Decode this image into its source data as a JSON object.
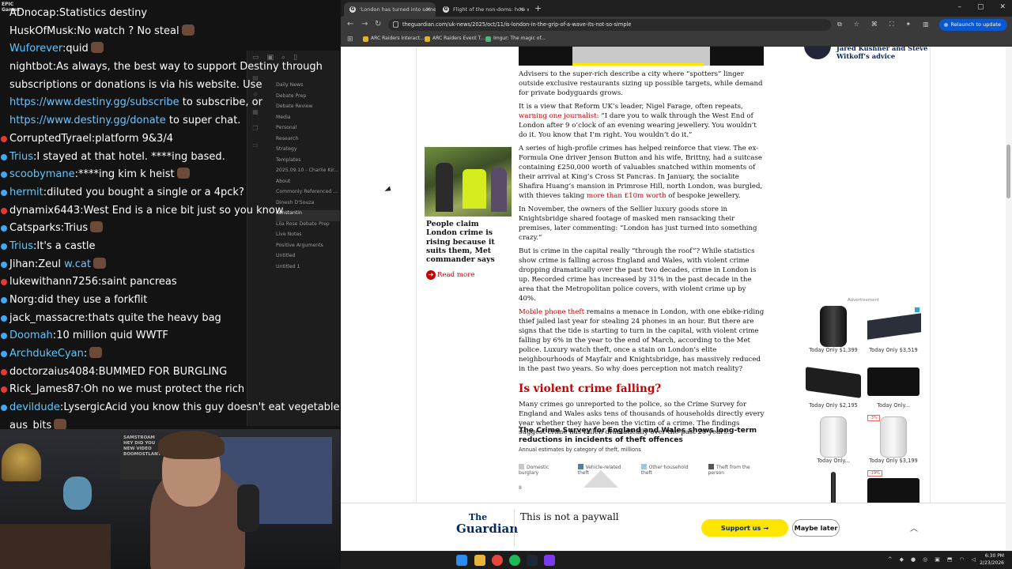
{
  "chat": {
    "badge": "EPIC\nGames",
    "lines": [
      {
        "user": "ADnocap",
        "text": "Statistics destiny",
        "dot": "none",
        "user_color": "white"
      },
      {
        "user": "HuskOfMusk",
        "text": "No watch ? No steal",
        "dot": "none",
        "user_color": "white",
        "emote": true
      },
      {
        "user": "Wuforever",
        "text": "quid",
        "dot": "none",
        "user_color": "blue",
        "emote": true
      },
      {
        "user": "nightbot",
        "text": "As always, the best way to support Destiny through",
        "dot": "none",
        "user_color": "white"
      },
      {
        "user": "",
        "text": "subscriptions or donations is via his website. Use",
        "dot": "none",
        "user_color": "white"
      },
      {
        "user": "",
        "text": "",
        "link": "https://www.destiny.gg/subscribe",
        "after": " to subscribe, or",
        "dot": "none"
      },
      {
        "user": "",
        "text": "",
        "link": "https://www.destiny.gg/donate",
        "after": " to super chat.",
        "dot": "none"
      },
      {
        "user": "CorruptedTyrael",
        "text": "platform 9&3/4",
        "dot": "red",
        "user_color": "white"
      },
      {
        "user": "Trius",
        "text": "I stayed at that hotel. ****ing based.",
        "dot": "blue",
        "user_color": "blue"
      },
      {
        "user": "scoobymane",
        "text": "****ing kim k heist",
        "dot": "blue",
        "user_color": "blue",
        "emote": true
      },
      {
        "user": "hermit",
        "text": "diluted you bought a single or a 4pck?",
        "dot": "blue",
        "user_color": "blue"
      },
      {
        "user": "dynamix6443",
        "text": "West End is a nice bit just so you know",
        "dot": "red",
        "user_color": "white"
      },
      {
        "user": "Catsparks",
        "text": "Trius",
        "dot": "blue",
        "user_color": "white",
        "emote": true
      },
      {
        "user": "Trius",
        "text": "It's a castle",
        "dot": "blue",
        "user_color": "blue"
      },
      {
        "user": "Jihan",
        "text": "Zeul ",
        "link": "w.cat",
        "dot": "blue",
        "user_color": "white",
        "emote": true
      },
      {
        "user": "lukewithann7256",
        "text": "saint pancreas",
        "dot": "red",
        "user_color": "white"
      },
      {
        "user": "Norg",
        "text": "did they use a forkflit",
        "dot": "blue",
        "user_color": "white"
      },
      {
        "user": "jack_massacre",
        "text": "thats quite the heavy bag",
        "dot": "blue",
        "user_color": "white"
      },
      {
        "user": "Doomah",
        "text": "10 million quid WWTF",
        "dot": "blue",
        "user_color": "blue"
      },
      {
        "user": "ArchdukeCyan",
        "text": "",
        "dot": "blue",
        "user_color": "blue",
        "emote": true
      },
      {
        "user": "doctorzaius4084",
        "text": "BUMMED FOR BURGLING",
        "dot": "red",
        "user_color": "white"
      },
      {
        "user": "Rick_James87",
        "text": "Oh no we must protect the rich",
        "dot": "red",
        "user_color": "white"
      },
      {
        "user": "devildude",
        "text": "LysergicAcid you know this guy doesn't eat vegetables",
        "dot": "blue",
        "user_color": "blue"
      },
      {
        "user": "",
        "text": "aus_bits",
        "dot": "none",
        "user_color": "white",
        "emote": true
      }
    ]
  },
  "obsidian": {
    "items": [
      "Daily News",
      "Debate Prep",
      "Debate Review",
      "Media",
      "Personal",
      "Research",
      "Strategy",
      "Templates",
      "2025.09.10 - Charlie Kir...",
      "About",
      "Commonly Referenced ...",
      "Dinesh D'Souza",
      "Konstantin",
      "Lila Rose Debate Prep",
      "Live Notes",
      "Positive Arguments",
      "Untitled",
      "Untitled 1"
    ],
    "active_index": 12
  },
  "webcam": {
    "poster_text": "SAMSTROAM\nHEY DID YOU\nNEW VIDEO\nBOOMOSTLANT"
  },
  "browser": {
    "tabs": [
      {
        "title": "'London has turned into someth...",
        "favicon": "G",
        "active": true
      },
      {
        "title": "Flight of the non-doms: how w...",
        "favicon": "G",
        "active": false
      }
    ],
    "new_tab": "+",
    "window_controls": [
      "–",
      "▢",
      "✕"
    ],
    "url": "theguardian.com/uk-news/2025/oct/11/is-london-in-the-grip-of-a-wave-its-not-so-simple",
    "relaunch_label": "Relaunch to update",
    "bookmarks": [
      "ARC Raiders Interact...",
      "ARC Raiders Event T...",
      "Imgur: The magic of..."
    ]
  },
  "article": {
    "paragraphs": [
      {
        "text": "Advisers to the super-rich describe a city where “spotters” linger outside exclusive restaurants sizing up possible targets, while demand for private bodyguards grows."
      },
      {
        "pre": "It is a view that Reform UK’s leader, Nigel Farage, often repeats, ",
        "link": "warning one journalist",
        "post": ": “I dare you to walk through the West End of London after 9 o’clock of an evening wearing jewellery. You wouldn’t do it. You know that I’m right. You wouldn’t do it.”"
      },
      {
        "pre": "A series of high-profile crimes has helped reinforce that view. The ex-Formula One driver Jenson Button and his wife, Brittny, had a suitcase containing £250,000 worth of valuables snatched within moments of their arrival at King’s Cross St Pancras. In January, the socialite Shafira Huang’s mansion in Primrose Hill, north London, was burgled, with thieves taking ",
        "link": "more than £10m worth",
        "post": " of bespoke jewellery."
      },
      {
        "text": "In November, the owners of the Sellier luxury goods store in Knightsbridge shared footage of masked men ransacking their premises, later commenting: “London has just turned into something crazy.”"
      },
      {
        "text": "But is crime in the capital really “through the roof”? While statistics show crime is falling across England and Wales, with violent crime dropping dramatically over the past two decades, crime in London is up. Recorded crime has increased by 31% in the past decade in the area that the Metropolitan police covers, with violent crime up by 40%."
      },
      {
        "pre": "",
        "link": "Mobile phone theft",
        "post": " remains a menace in London, with one ebike-riding thief jailed last year for stealing 24 phones in an hour. But there are signs that the tide is starting to turn in the capital, with violent crime falling by 6% in the year to the end of March, according to the Met police. Luxury watch theft, once a stain on London’s elite neighbourhoods of Mayfair and Knightsbridge, has massively reduced in the past two years. So why does perception not match reality?"
      }
    ],
    "subhead": "Is violent crime falling?",
    "after_subhead": "Many crimes go unreported to the police, so the Crime Survey for England and Wales asks tens of thousands of households directly every year whether they have been the victim of a crime. The findings suggest crime has fallen dramatically over the past 20 years."
  },
  "promo": {
    "headline": "People claim London crime is rising because it suits them, Met commander says",
    "read_more": "Read more"
  },
  "chart_data": {
    "type": "area",
    "title": "The Crime Survey for England and Wales shows long-term reductions in incidents of theft offences",
    "subtitle": "Annual estimates by category of theft, millions",
    "series": [
      {
        "name": "Domestic burglary",
        "color": "#c8c8c8"
      },
      {
        "name": "Vehicle-related theft",
        "color": "#4a7fb0"
      },
      {
        "name": "Other household theft",
        "color": "#9bc7e8"
      },
      {
        "name": "Theft from the person",
        "color": "#555555"
      }
    ],
    "y_top_tick": "8"
  },
  "sidebar": {
    "headline": "Jared Kushner and Steve Witkoff’s advice"
  },
  "ad": {
    "label": "Advertisement",
    "items": [
      {
        "price": "Today Only $1,399",
        "kind": "lens"
      },
      {
        "price": "Today Only $3,519",
        "kind": "box"
      },
      {
        "price": "Today Only $2,195",
        "kind": "mixer"
      },
      {
        "price": "Today Only...",
        "kind": "switcher"
      },
      {
        "price": "Today Only...",
        "kind": "white-lens"
      },
      {
        "price": "Today Only $3,199",
        "kind": "white-lens",
        "badge": "-3%"
      },
      {
        "price": "",
        "kind": "tripod"
      },
      {
        "price": "",
        "kind": "switcher",
        "badge": "-19%"
      }
    ]
  },
  "paywall": {
    "logo_the": "The",
    "logo_guardian": "Guardian",
    "message": "This is not a paywall",
    "support_label": "Support us",
    "later_label": "Maybe later"
  },
  "taskbar": {
    "time": "6:30 PM",
    "date": "2/23/2026"
  }
}
